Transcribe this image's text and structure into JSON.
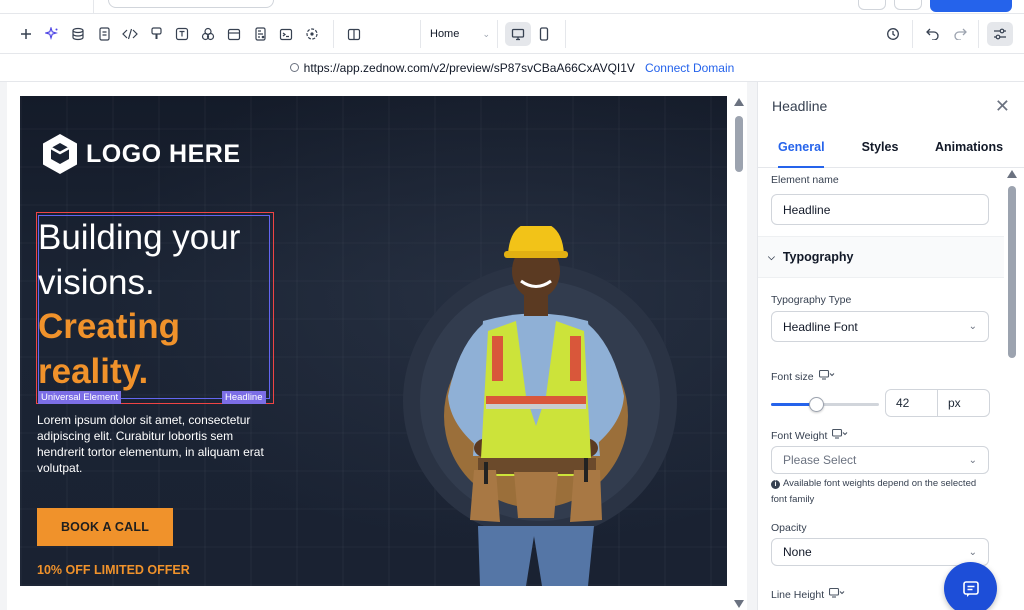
{
  "toolbar": {
    "page_select": "Home"
  },
  "urlbar": {
    "url": "https://app.zednow.com/v2/preview/sP87svCBaA66CxAVQI1V",
    "connect_label": "Connect Domain"
  },
  "hero": {
    "logo_text": "LOGO HERE",
    "headline_line1": "Building your",
    "headline_line2": "visions.",
    "headline_accent1": "Creating",
    "headline_accent2": "reality.",
    "tag_universal": "Universal Element",
    "tag_headline": "Headline",
    "body": "Lorem ipsum dolor sit amet, consectetur adipiscing elit. Curabitur lobortis sem hendrerit tortor elementum, in aliquam erat volutpat.",
    "cta_label": "BOOK A CALL",
    "offer": "10% OFF LIMITED OFFER",
    "accent_color": "#f0922b",
    "bg_color": "#1a2232"
  },
  "panel": {
    "title": "Headline",
    "tabs": [
      "General",
      "Styles",
      "Animations"
    ],
    "element_name_label": "Element name",
    "element_name_value": "Headline",
    "section_typography": "Typography",
    "typography_type_label": "Typography Type",
    "typography_type_value": "Headline Font",
    "font_size_label": "Font size",
    "font_size_value": "42",
    "font_size_unit": "px",
    "font_size_slider_fraction": 0.42,
    "font_weight_label": "Font Weight",
    "font_weight_placeholder": "Please Select",
    "font_weight_note": "Available font weights depend on the selected font family",
    "opacity_label": "Opacity",
    "opacity_value": "None",
    "line_height_label": "Line Height"
  }
}
